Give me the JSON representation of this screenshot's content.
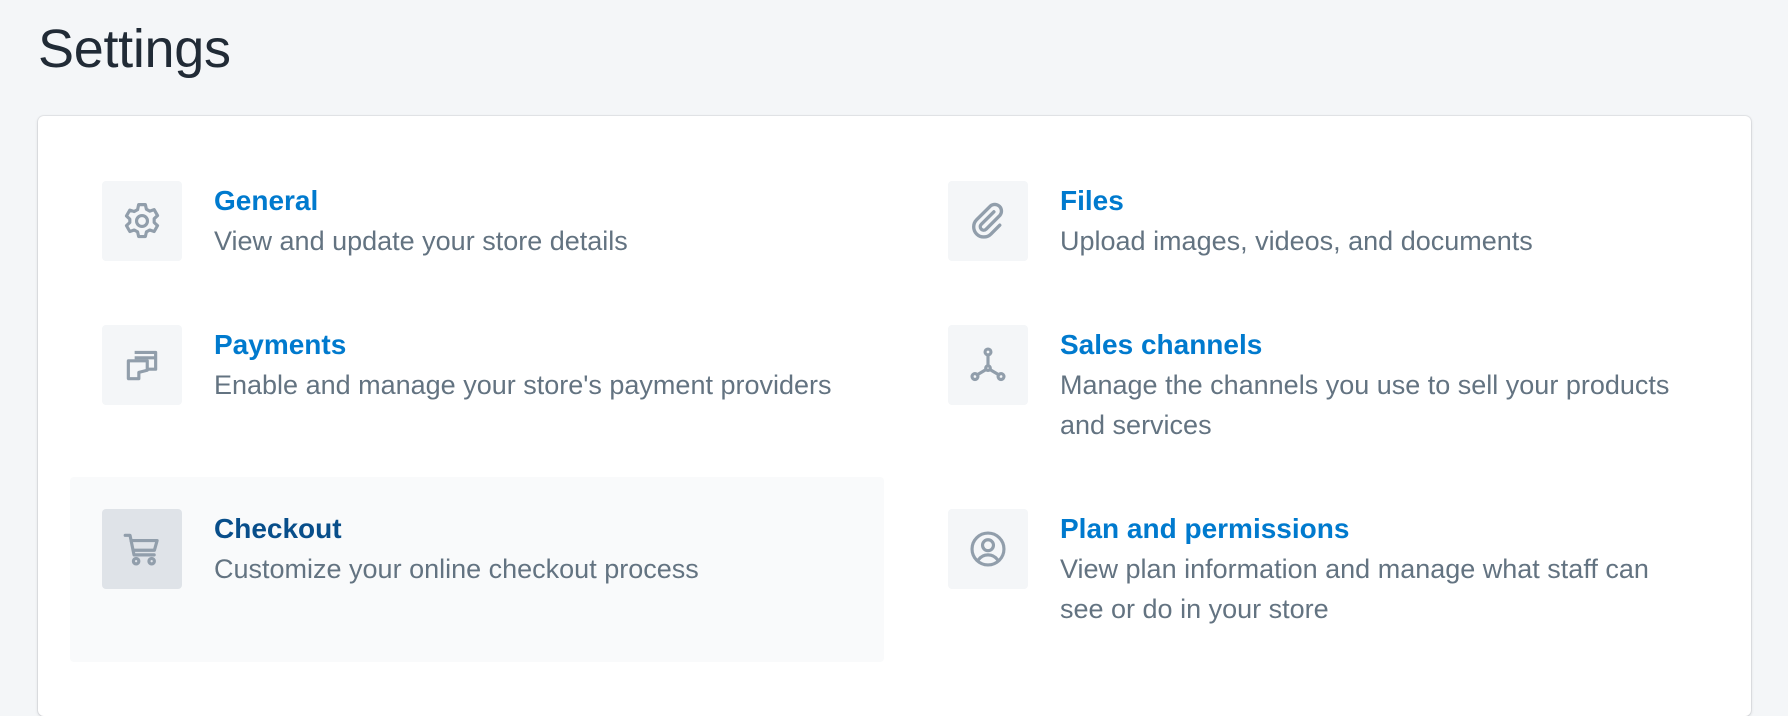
{
  "page": {
    "title": "Settings"
  },
  "items": [
    {
      "key": "general",
      "title": "General",
      "description": "View and update your store details",
      "icon": "gear-icon"
    },
    {
      "key": "files",
      "title": "Files",
      "description": "Upload images, videos, and documents",
      "icon": "paperclip-icon"
    },
    {
      "key": "payments",
      "title": "Payments",
      "description": "Enable and manage your store's payment providers",
      "icon": "payment-cards-icon"
    },
    {
      "key": "sales-channels",
      "title": "Sales channels",
      "description": "Manage the channels you use to sell your products and services",
      "icon": "channels-icon"
    },
    {
      "key": "checkout",
      "title": "Checkout",
      "description": "Customize your online checkout process",
      "icon": "cart-icon"
    },
    {
      "key": "plan-permissions",
      "title": "Plan and permissions",
      "description": "View plan information and manage what staff can see or do in your store",
      "icon": "profile-icon"
    }
  ],
  "colors": {
    "link": "#007ace",
    "link_hover": "#084e8a",
    "subdued_text": "#637381",
    "icon": "#919eab",
    "background": "#f4f6f8"
  }
}
